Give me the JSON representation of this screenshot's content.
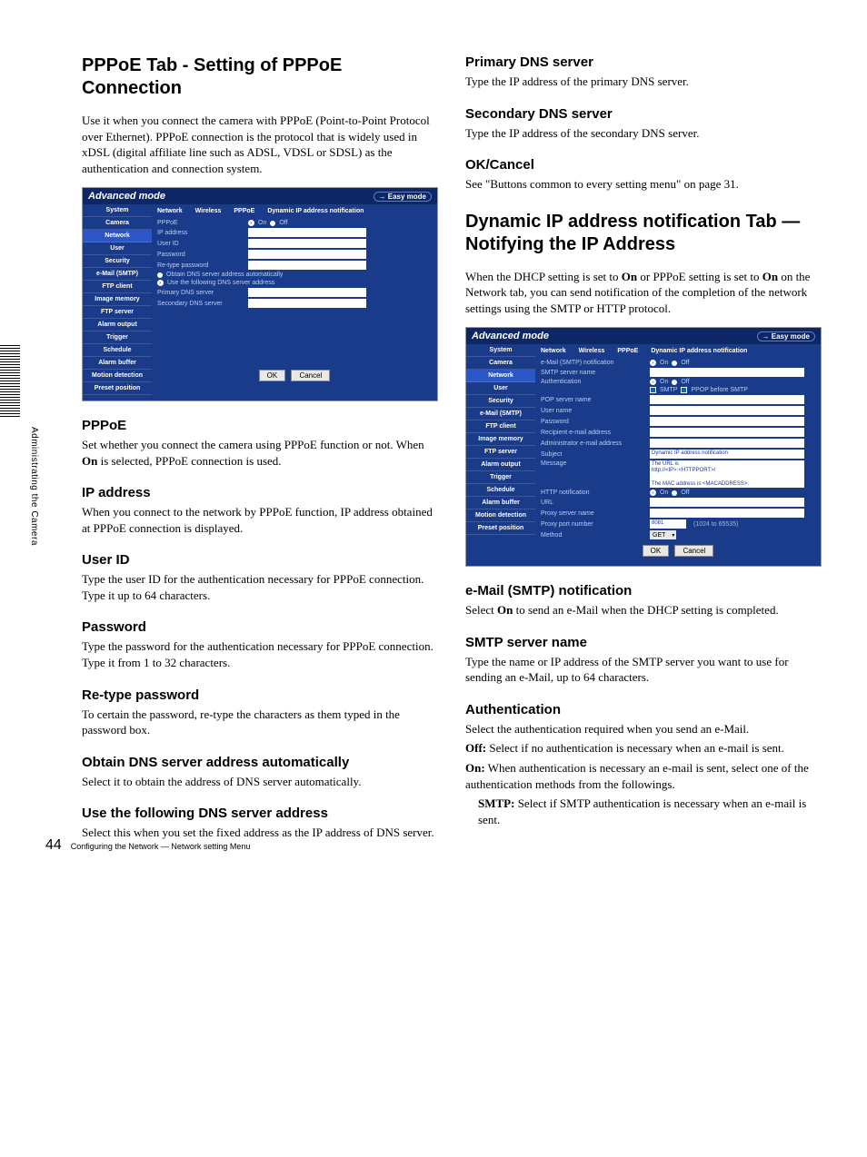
{
  "sidebar": {
    "text": "Administrating the Camera"
  },
  "left": {
    "h1": "PPPoE Tab - Setting of PPPoE Connection",
    "intro": "Use it when you connect the camera with PPPoE (Point-to-Point Protocol over Ethernet). PPPoE connection is the protocol that is widely used in xDSL (digital affiliate line such as ADSL, VDSL or SDSL) as the authentication and connection system.",
    "sections": [
      {
        "title": "PPPoE",
        "body": [
          "Set whether you connect the camera using PPPoE function or not. When ",
          "On",
          " is selected, PPPoE connection is used."
        ]
      },
      {
        "title": "IP address",
        "body": [
          "When you connect to the network by PPPoE function, IP address obtained at PPPoE connection is displayed."
        ]
      },
      {
        "title": "User ID",
        "body": [
          "Type the user ID for the authentication necessary for PPPoE connection. Type it up to 64 characters."
        ]
      },
      {
        "title": "Password",
        "body": [
          "Type the password for the authentication necessary for PPPoE connection. Type it from 1 to 32 characters."
        ]
      },
      {
        "title": "Re-type password",
        "body": [
          "To certain the password, re-type the characters as them typed in the password box."
        ]
      },
      {
        "title": "Obtain DNS server address automatically",
        "body": [
          "Select it to obtain the address of DNS server automatically."
        ]
      },
      {
        "title": "Use the following DNS server address",
        "body": [
          "Select this when you set the fixed address as the IP address of DNS server."
        ]
      }
    ]
  },
  "right": {
    "top_sections": [
      {
        "title": "Primary DNS server",
        "body": "Type the IP address of the primary DNS server."
      },
      {
        "title": "Secondary DNS server",
        "body": "Type the IP address of the secondary DNS server."
      },
      {
        "title": "OK/Cancel",
        "body": "See \"Buttons common to every setting menu\" on page 31."
      }
    ],
    "h1": "Dynamic IP address notification Tab — Notifying the IP Address",
    "intro1": "When the DHCP setting is set to ",
    "intro_on1": "On",
    "intro2": " or PPPoE setting is set to ",
    "intro_on2": "On",
    "intro3": " on the Network tab, you can send notification of the completion of the network settings using the SMTP or HTTP protocol.",
    "bot_sections": {
      "s1": {
        "title": "e-Mail (SMTP) notification",
        "body1": "Select ",
        "on": "On",
        "body2": " to send an e-Mail when the DHCP setting is completed."
      },
      "s2": {
        "title": "SMTP server name",
        "body": "Type the name or IP address of the SMTP server you want to use for sending an e-Mail, up to 64 characters."
      },
      "s3": {
        "title": "Authentication",
        "intro": "Select the authentication required when you send an e-Mail.",
        "off_label": "Off:",
        "off_body": " Select if no authentication is necessary when an e-mail is sent.",
        "on_label": "On:",
        "on_body": " When authentication is necessary an e-mail is sent, select one of the authentication methods from the followings.",
        "smtp_label": "SMTP:",
        "smtp_body": " Select if SMTP authentication is necessary when an e-mail is sent."
      }
    }
  },
  "fig1": {
    "header": "Advanced mode",
    "easy": "→ Easy mode",
    "nav": [
      "System",
      "Camera",
      "Network",
      "User",
      "Security",
      "e-Mail (SMTP)",
      "FTP client",
      "Image memory",
      "FTP server",
      "Alarm output",
      "Trigger",
      "Schedule",
      "Alarm buffer",
      "Motion detection",
      "Preset position"
    ],
    "nav_active": 2,
    "tabs": [
      "Network",
      "Wireless",
      "PPPoE",
      "Dynamic IP address notification"
    ],
    "pppoe_label": "PPPoE",
    "on": "On",
    "off": "Off",
    "fields": [
      "IP address",
      "User ID",
      "Password",
      "Re-type password"
    ],
    "radio1": "Obtain DNS server address automatically",
    "radio2": "Use the following DNS server address",
    "dns1": "Primary DNS server",
    "dns2": "Secondary DNS server",
    "ok": "OK",
    "cancel": "Cancel"
  },
  "fig2": {
    "header": "Advanced mode",
    "easy": "→ Easy mode",
    "nav": [
      "System",
      "Camera",
      "Network",
      "User",
      "Security",
      "e-Mail (SMTP)",
      "FTP client",
      "Image memory",
      "FTP server",
      "Alarm output",
      "Trigger",
      "Schedule",
      "Alarm buffer",
      "Motion detection",
      "Preset position"
    ],
    "nav_active": 2,
    "tabs": [
      "Network",
      "Wireless",
      "PPPoE",
      "Dynamic IP address notification"
    ],
    "row_smtpnotif": "e-Mail (SMTP) notification",
    "on": "On",
    "off": "Off",
    "row_smtpserver": "SMTP server name",
    "row_auth": "Authentication",
    "chk_smtp": "SMTP",
    "chk_pop": "PPOP before SMTP",
    "row_pop": "POP server name",
    "row_user": "User name",
    "row_pass": "Password",
    "row_recip": "Recipient e-mail address",
    "row_admin": "Administrator e-mail address",
    "row_subject": "Subject",
    "subject_val": "Dynamic IP address notification",
    "row_message": "Message",
    "msg_val": "The URL is\nhttp://<IP>:<HTTPPORT>/\n\nThe MAC address is <MACADDRESS>.",
    "row_httpnotif": "HTTP notification",
    "row_url": "URL",
    "row_proxy": "Proxy server name",
    "row_proxyport": "Proxy port number",
    "proxyport_val": "8081",
    "proxyport_hint": "(1024 to 65535)",
    "row_method": "Method",
    "method_val": "GET",
    "ok": "OK",
    "cancel": "Cancel"
  },
  "footer": {
    "page": "44",
    "text": "Configuring the Network — Network setting Menu"
  }
}
